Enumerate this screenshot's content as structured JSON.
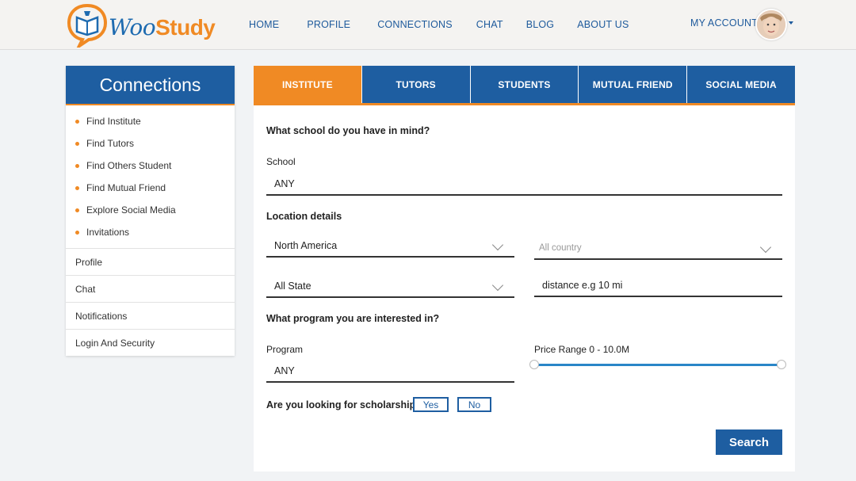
{
  "header": {
    "logo_woo": "Woo",
    "logo_study": "Study",
    "nav": [
      "HOME",
      "PROFILE",
      "CONNECTIONS",
      "CHAT",
      "BLOG",
      "ABOUT US"
    ],
    "account_label": "MY ACCOUNT"
  },
  "sidebar": {
    "title": "Connections",
    "sub_items": [
      "Find Institute",
      "Find Tutors",
      "Find Others Student",
      "Find Mutual Friend",
      "Explore Social Media",
      "Invitations"
    ],
    "main_items": [
      "Profile",
      "Chat",
      "Notifications",
      "Login And Security"
    ]
  },
  "tabs": [
    "INSTITUTE",
    "TUTORS",
    "STUDENTS",
    "MUTUAL FRIEND",
    "SOCIAL MEDIA"
  ],
  "active_tab": "INSTITUTE",
  "form": {
    "school_question": "What school do you have in mind?",
    "school_label": "School",
    "school_value": "ANY",
    "location_label": "Location details",
    "region_value": "North America",
    "country_placeholder": "All country",
    "state_value": "All State",
    "distance_placeholder": "distance e.g 10 mi",
    "program_question": "What program you are interested in?",
    "program_label": "Program",
    "program_value": "ANY",
    "price_label": "Price Range 0 - 10.0M",
    "price_range_fraction": [
      0,
      1
    ],
    "scholarship_question": "Are you looking for scholarship?",
    "yes_label": "Yes",
    "no_label": "No",
    "search_label": "Search"
  },
  "colors": {
    "brand_blue": "#1e5ea1",
    "brand_orange": "#f08a24"
  }
}
